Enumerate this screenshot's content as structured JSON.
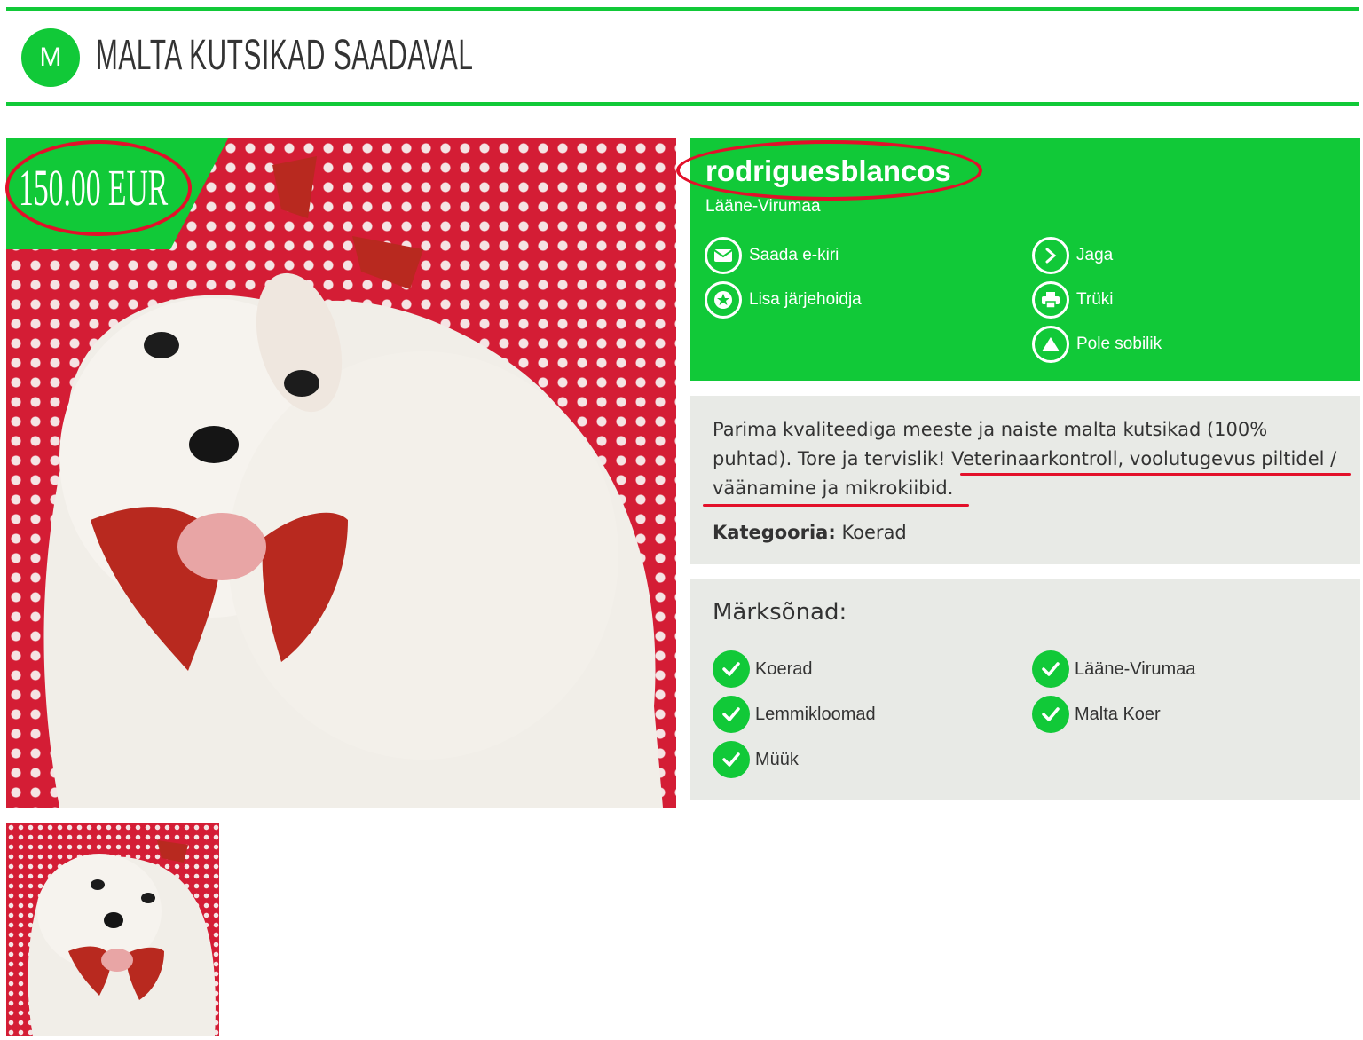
{
  "header": {
    "logo_letter": "M",
    "title": "MALTA KUTSIKAD SAADAVAL"
  },
  "listing": {
    "price": "150.00 EUR",
    "seller": {
      "name": "rodriguesblancos",
      "region": "Lääne-Virumaa"
    },
    "actions": [
      {
        "label": "Saada e-kiri",
        "icon": "envelope-icon"
      },
      {
        "label": "Jaga",
        "icon": "share-arrow-icon"
      },
      {
        "label": "Lisa järjehoidja",
        "icon": "star-icon"
      },
      {
        "label": "Trüki",
        "icon": "printer-icon"
      },
      {
        "label": "Pole sobilik",
        "icon": "warning-triangle-icon"
      }
    ],
    "description": {
      "part1": "Parima kvaliteediga meeste ja naiste malta kutsikad (100% puhtad). Tore ja tervislik! Veterinaarkontroll, voolutugevus piltidel / väänamine ja mikrokiibid",
      "part2": "."
    },
    "category": {
      "label": "Kategooria:",
      "value": "Koerad"
    },
    "tags": {
      "title": "Märksõnad:",
      "items": [
        "Koerad",
        "Lääne-Virumaa",
        "Lemmikloomad",
        "Malta Koer",
        "Müük"
      ]
    }
  },
  "colors": {
    "brand_green": "#11c938",
    "panel_gray": "#e8eae6",
    "annotation_red": "#e3102a"
  }
}
